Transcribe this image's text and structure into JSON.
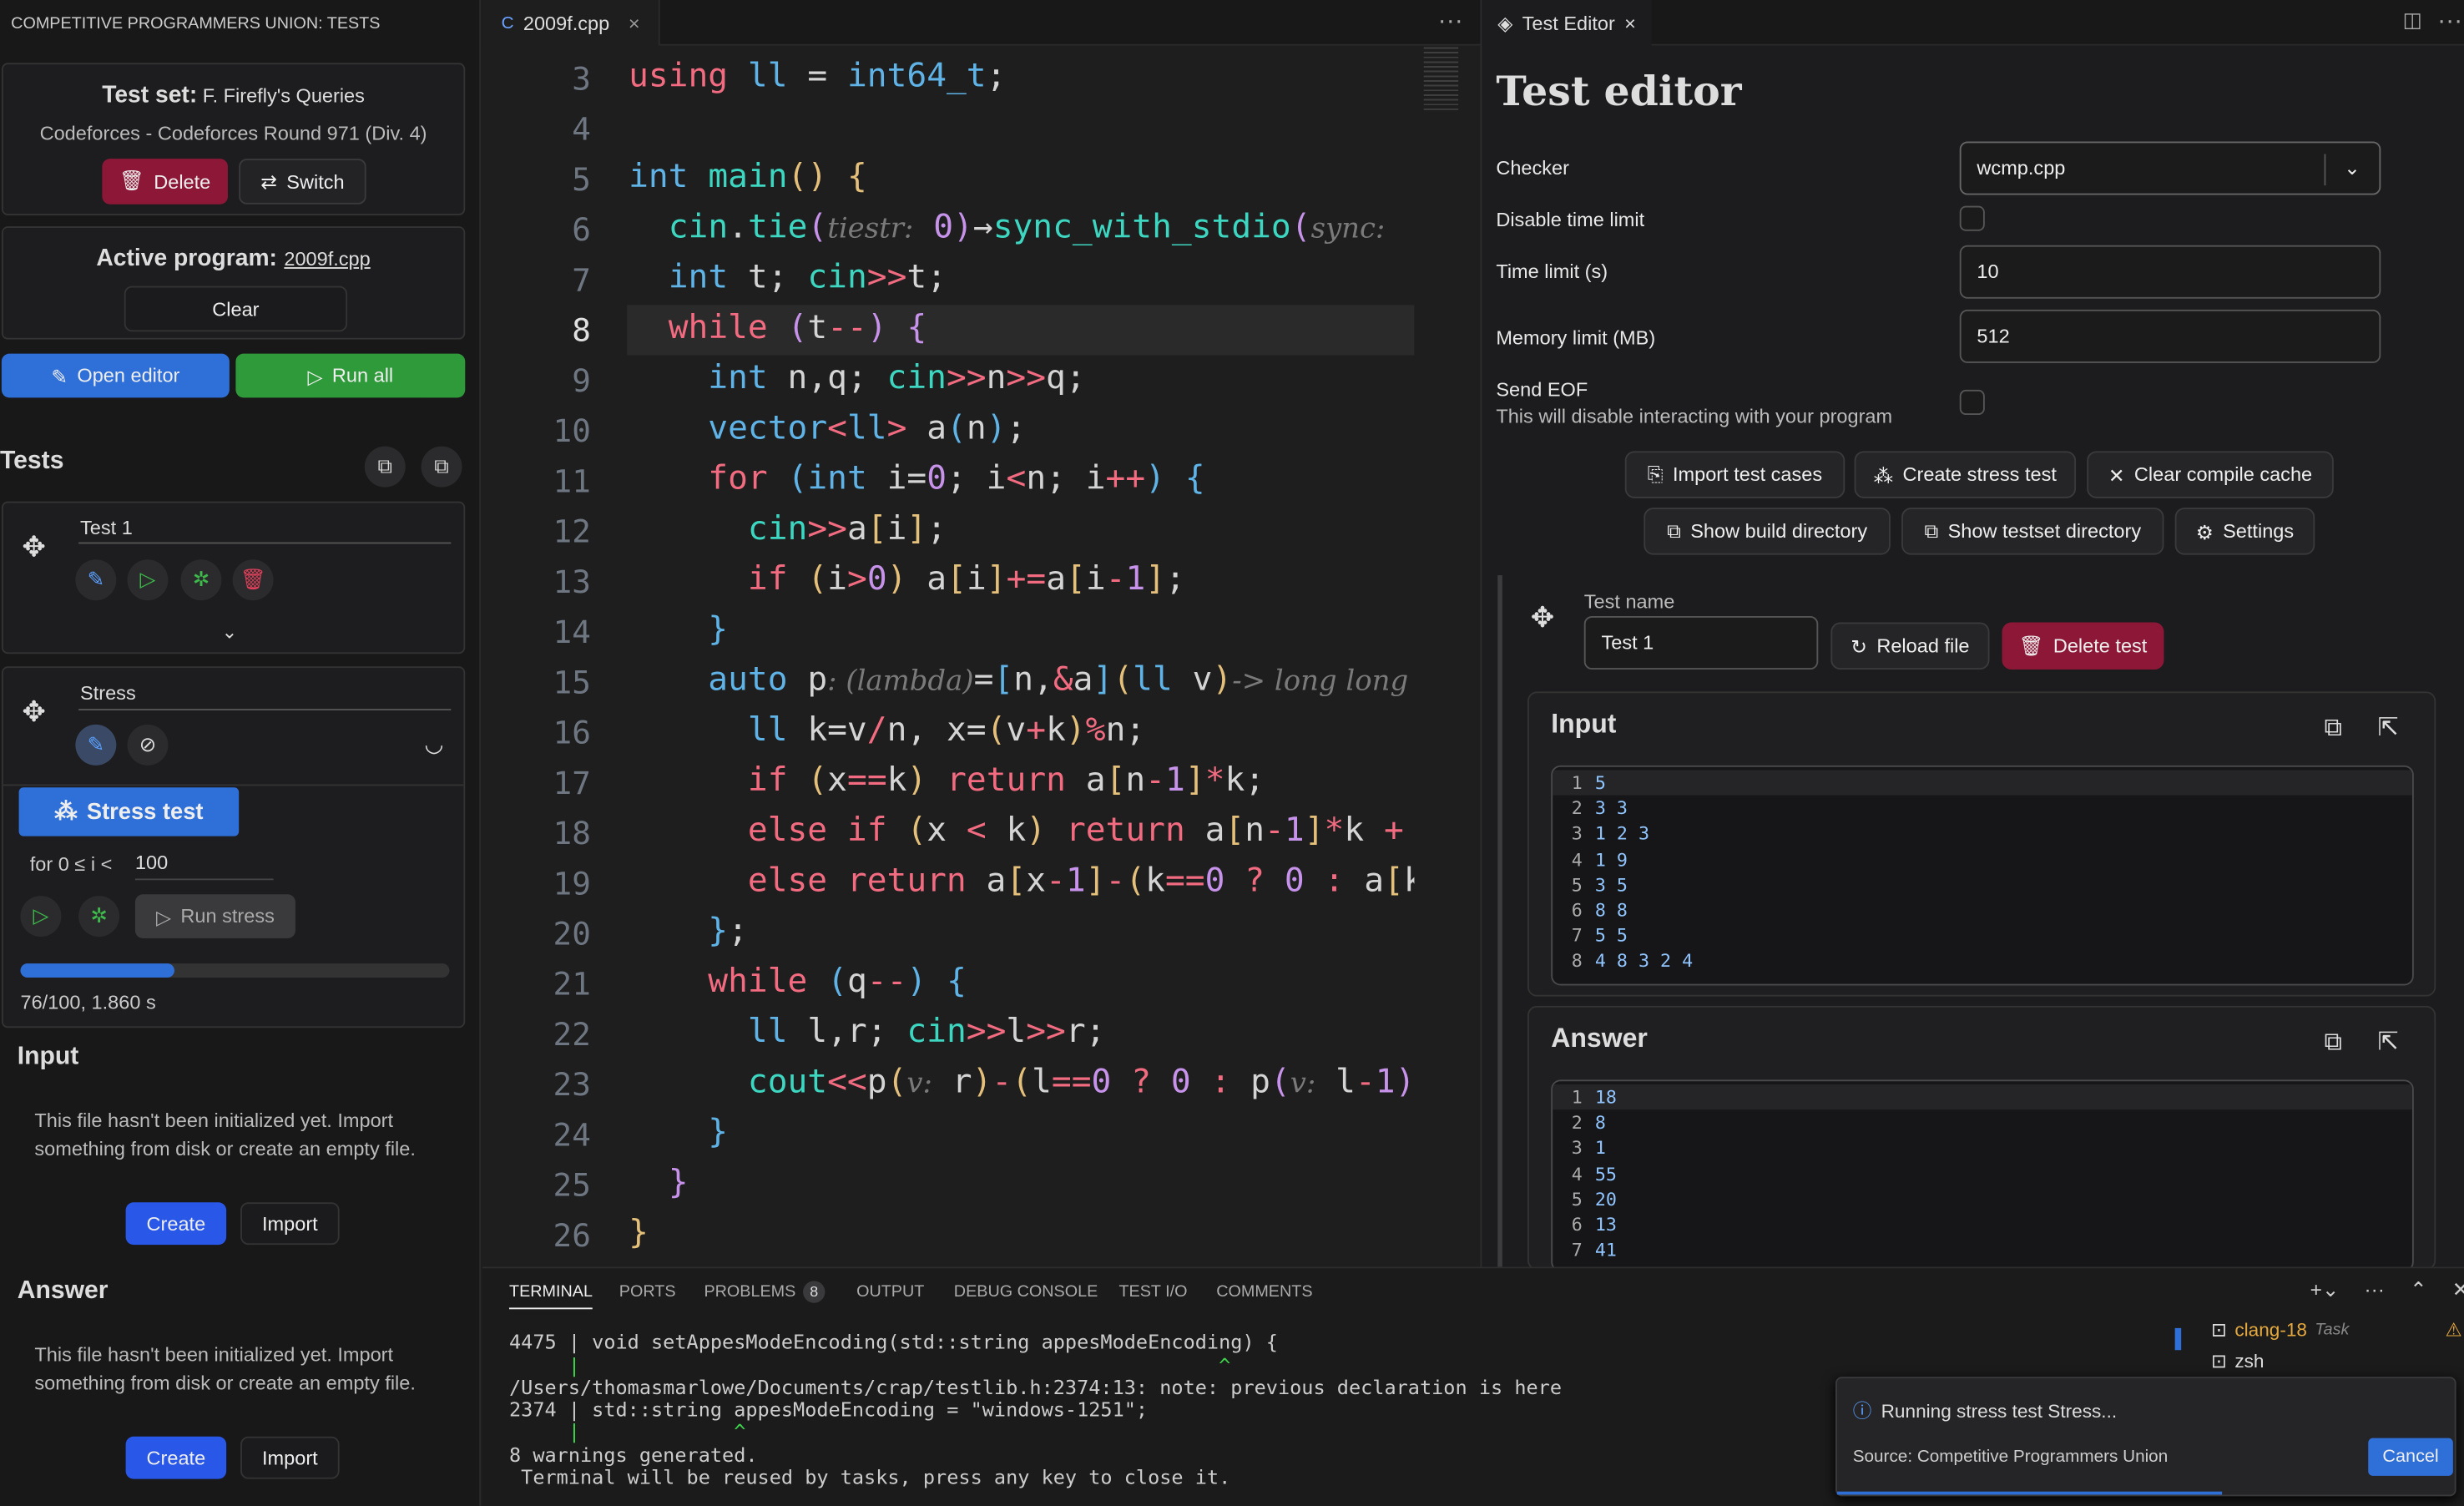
{
  "sidebar": {
    "header": "COMPETITIVE PROGRAMMERS UNION: TESTS",
    "testset_label": "Test set:",
    "testset_name": "F. Firefly's Queries",
    "testset_source": "Codeforces - Codeforces Round 971 (Div. 4)",
    "delete": "Delete",
    "switch": "Switch",
    "active_label": "Active program:",
    "active_file": "2009f.cpp",
    "clear": "Clear",
    "open_editor": "Open editor",
    "run_all": "Run all",
    "tests_title": "Tests",
    "test1_name": "Test 1",
    "stress_name": "Stress",
    "stress_tab": "Stress test",
    "loop_text": "for 0 ≤ i <",
    "loop_value": "100",
    "run_stress": "Run stress",
    "progress": 0.36,
    "progress_text": "76/100, 1.860 s",
    "input_title": "Input",
    "input_msg": "This file hasn't been initialized yet. Import something from disk or create an empty file.",
    "answer_title": "Answer",
    "answer_msg": "This file hasn't been initialized yet. Import something from disk or create an empty file.",
    "create": "Create",
    "import": "Import"
  },
  "editor": {
    "tab": "2009f.cpp",
    "line_numbers": [
      "3",
      "4",
      "5",
      "6",
      "7",
      "8",
      "9",
      "10",
      "11",
      "12",
      "13",
      "14",
      "15",
      "16",
      "17",
      "18",
      "19",
      "20",
      "21",
      "22",
      "23",
      "24",
      "25",
      "26"
    ],
    "active_line": "8"
  },
  "test_editor": {
    "tab": "Test Editor",
    "title": "Test editor",
    "checker_label": "Checker",
    "checker_value": "wcmp.cpp",
    "disable_time_label": "Disable time limit",
    "time_label": "Time limit (s)",
    "time_value": "10",
    "mem_label": "Memory limit (MB)",
    "mem_value": "512",
    "eof_label": "Send EOF",
    "eof_sub": "This will disable interacting with your program",
    "import_cases": "Import test cases",
    "create_stress": "Create stress test",
    "clear_cache": "Clear compile cache",
    "show_build": "Show build directory",
    "show_testset": "Show testset directory",
    "settings": "Settings",
    "test_name_label": "Test name",
    "test_name_value": "Test 1",
    "reload": "Reload file",
    "delete_test": "Delete test",
    "input_title": "Input",
    "input_lines": [
      [
        "1",
        "5"
      ],
      [
        "2",
        "3 3"
      ],
      [
        "3",
        "1 2 3"
      ],
      [
        "4",
        "1 9"
      ],
      [
        "5",
        "3 5"
      ],
      [
        "6",
        "8 8"
      ],
      [
        "7",
        "5 5"
      ],
      [
        "8",
        "4 8 3 2 4"
      ]
    ],
    "answer_title": "Answer",
    "answer_lines": [
      [
        "1",
        "18"
      ],
      [
        "2",
        "8"
      ],
      [
        "3",
        "1"
      ],
      [
        "4",
        "55"
      ],
      [
        "5",
        "20"
      ],
      [
        "6",
        "13"
      ],
      [
        "7",
        "41"
      ]
    ]
  },
  "terminal": {
    "tabs": [
      "TERMINAL",
      "PORTS",
      "PROBLEMS",
      "OUTPUT",
      "DEBUG CONSOLE",
      "TEST I/O",
      "COMMENTS"
    ],
    "problems_count": "8",
    "lines": [
      "4475 | void setAppesModeEncoding(std::string appesModeEncoding) {",
      "     |                                                      ^",
      "/Users/thomasmarlowe/Documents/crap/testlib.h:2374:13: note: previous declaration is here",
      "2374 | std::string appesModeEncoding = \"windows-1251\";",
      "     |             ^",
      "8 warnings generated.",
      " Terminal will be reused by tasks, press any key to close it."
    ],
    "sessions": [
      "clang-18",
      "zsh"
    ],
    "task_badge": "Task",
    "toast": "Running stress test Stress...",
    "toast_source": "Source: Competitive Programmers Union",
    "cancel": "Cancel"
  },
  "colors": {
    "accent": "#2f6fd8",
    "run": "#2e9a3a",
    "danger": "#8c1737",
    "create": "#2957e8"
  }
}
